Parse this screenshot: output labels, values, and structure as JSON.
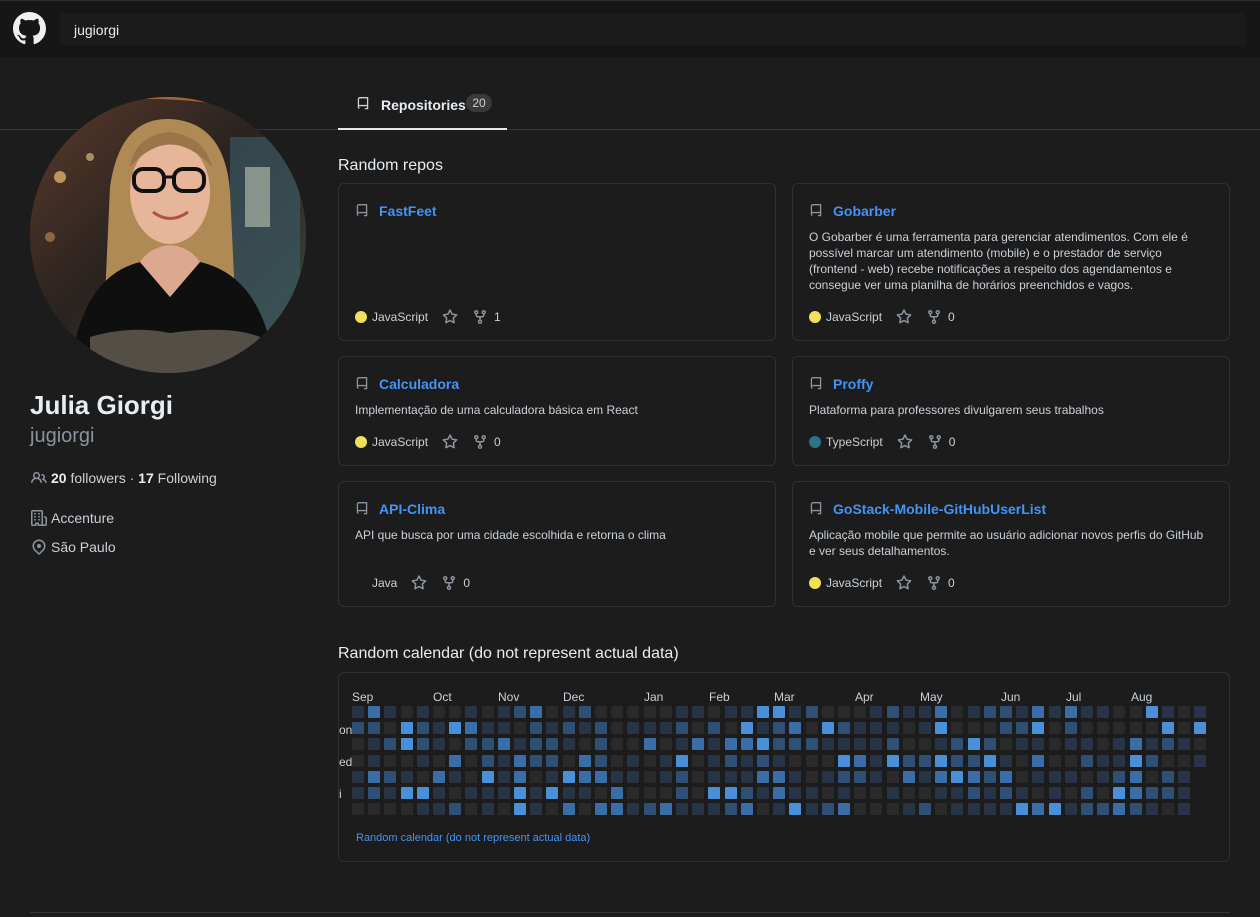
{
  "header": {
    "search_value": "jugiorgi",
    "logo": "github-mark-icon"
  },
  "tabs": [
    {
      "label": "Repositories",
      "count": "20",
      "icon": "repo-icon"
    }
  ],
  "profile": {
    "name": "Julia Giorgi",
    "login": "jugiorgi",
    "followers_count": "20",
    "followers_label": "followers",
    "separator": "·",
    "following_count": "17",
    "following_label": "Following",
    "company": "Accenture",
    "location": "São Paulo"
  },
  "random_repos": {
    "title": "Random repos",
    "repos": [
      {
        "name": "FastFeet",
        "description": "",
        "language": "JavaScript",
        "language_color": "#f1e05a",
        "forks": "1"
      },
      {
        "name": "Gobarber",
        "description": "O Gobarber é uma ferramenta para gerenciar atendimentos. Com ele é possível marcar um atendimento (mobile) e o prestador de serviço (frontend - web) recebe notificações a respeito dos agendamentos e consegue ver uma planilha de horários preenchidos e vagos.",
        "language": "JavaScript",
        "language_color": "#f1e05a",
        "forks": "0"
      },
      {
        "name": "Calculadora",
        "description": "Implementação de uma calculadora básica em React",
        "language": "JavaScript",
        "language_color": "#f1e05a",
        "forks": "0"
      },
      {
        "name": "Proffy",
        "description": "Plataforma para professores divulgarem seus trabalhos",
        "language": "TypeScript",
        "language_color": "#2b7489",
        "forks": "0"
      },
      {
        "name": "API-Clima",
        "description": "API que busca por uma cidade escolhida e retorna o clima",
        "language": "Java",
        "language_color": "",
        "forks": "0"
      },
      {
        "name": "GoStack-Mobile-GitHubUserList",
        "description": "Aplicação mobile que permite ao usuário adicionar novos perfis do GitHub e ver seus detalhamentos.",
        "language": "JavaScript",
        "language_color": "#f1e05a",
        "forks": "0"
      }
    ]
  },
  "calendar": {
    "title": "Random calendar (do not represent actual data)",
    "months": [
      "Sep",
      "Oct",
      "Nov",
      "Dec",
      "Jan",
      "Feb",
      "Mar",
      "Apr",
      "May",
      "Jun",
      "Jul",
      "Aug"
    ],
    "day_labels": [
      "on",
      "ed",
      "i"
    ],
    "footer_link": "Random calendar (do not represent actual data)",
    "level_colors": [
      "#2a2a2a",
      "#263446",
      "#2f4f75",
      "#3b6ea8",
      "#4a90d9"
    ]
  }
}
